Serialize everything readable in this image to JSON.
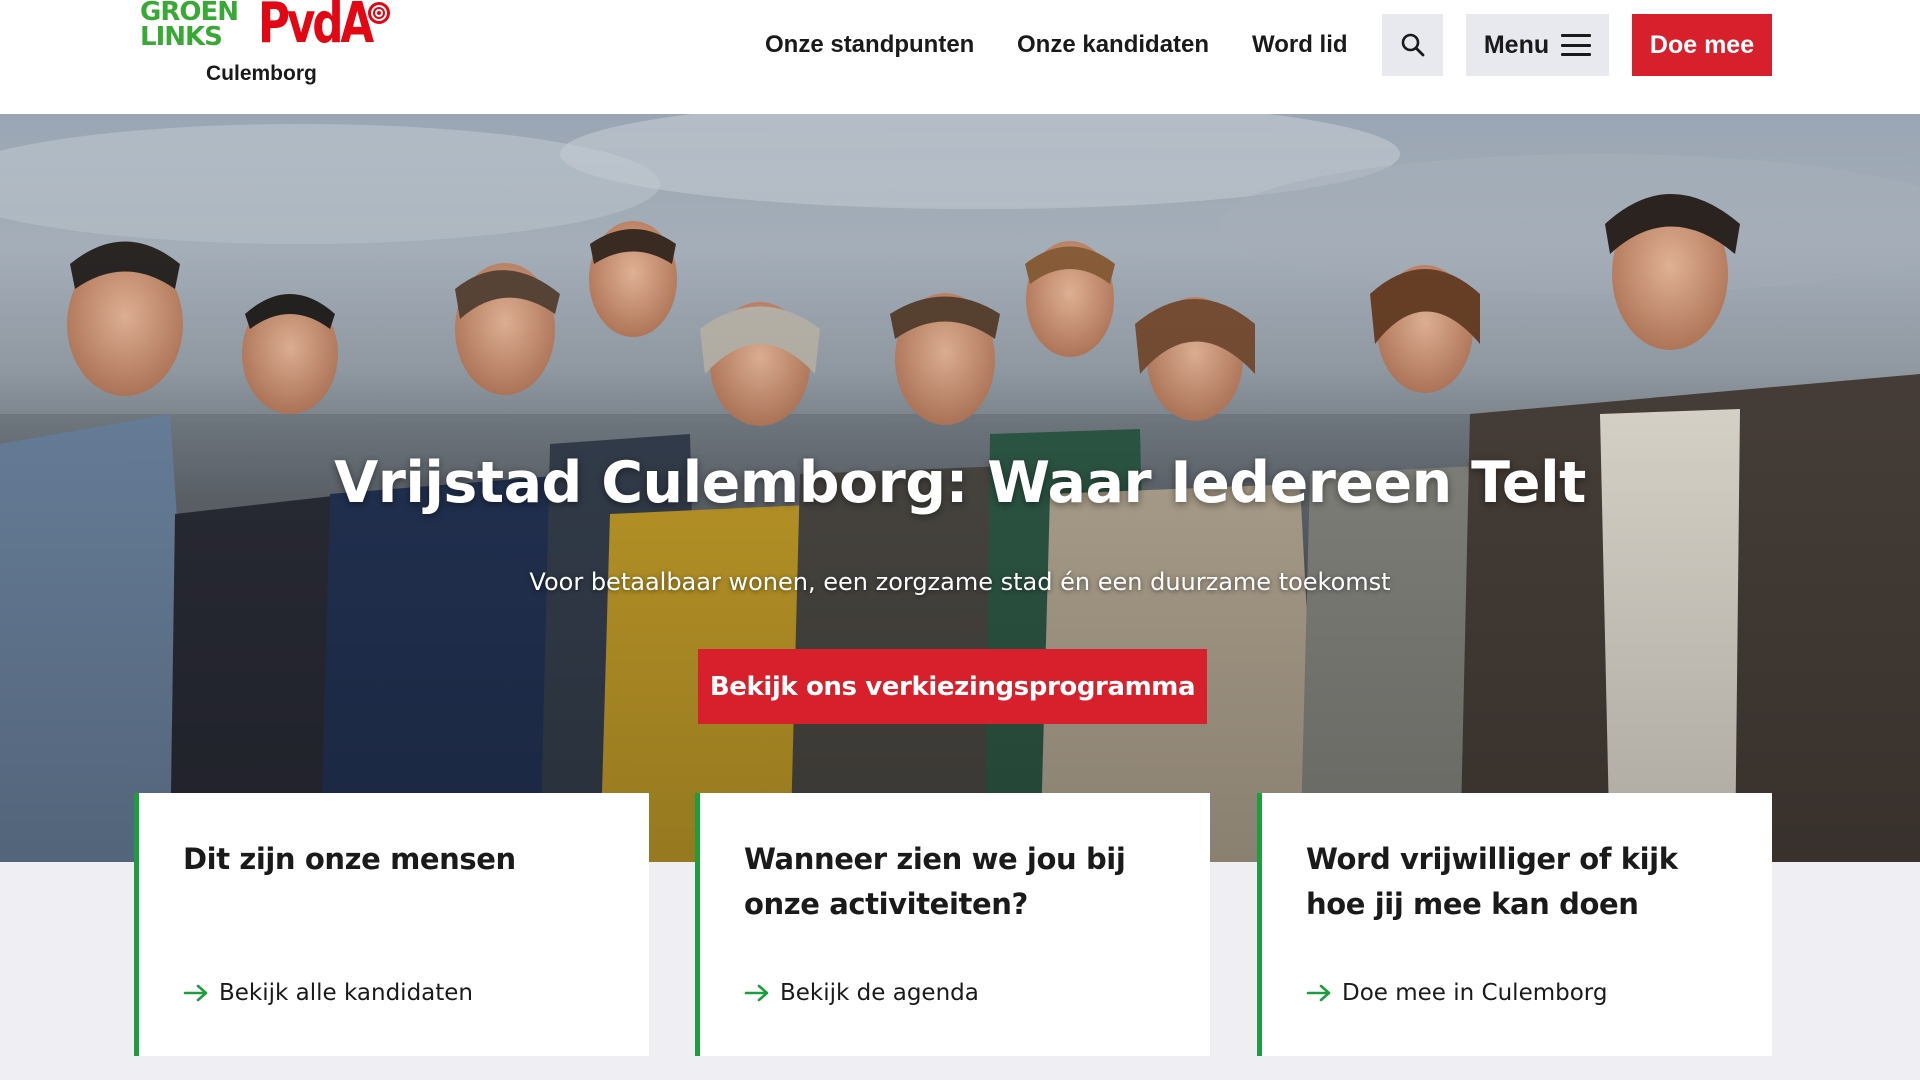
{
  "header": {
    "logo": {
      "line1": "GROEN",
      "line2": "LINKS",
      "brand": "PvdA",
      "city": "Culemborg"
    },
    "nav": [
      {
        "label": "Onze standpunten"
      },
      {
        "label": "Onze kandidaten"
      },
      {
        "label": "Word lid"
      }
    ],
    "search_icon": "search-icon",
    "menu_label": "Menu",
    "cta_label": "Doe mee"
  },
  "hero": {
    "title": "Vrijstad Culemborg: Waar Iedereen Telt",
    "subtitle": "Voor betaalbaar wonen, een zorgzame stad én een duurzame toekomst",
    "button_label": "Bekijk ons verkiezingsprogramma"
  },
  "cards": [
    {
      "title": "Dit zijn onze mensen",
      "link": "Bekijk alle kandidaten"
    },
    {
      "title": "Wanneer zien we jou bij onze activiteiten?",
      "link": "Bekijk de agenda"
    },
    {
      "title": "Word vrijwilliger of kijk hoe jij mee kan doen",
      "link": "Doe mee in Culemborg"
    }
  ],
  "colors": {
    "brand_red": "#d7202c",
    "brand_green": "#1d9e3e",
    "logo_green": "#39a935",
    "button_grey": "#e8e8ef",
    "page_bg": "#eeeef3"
  }
}
